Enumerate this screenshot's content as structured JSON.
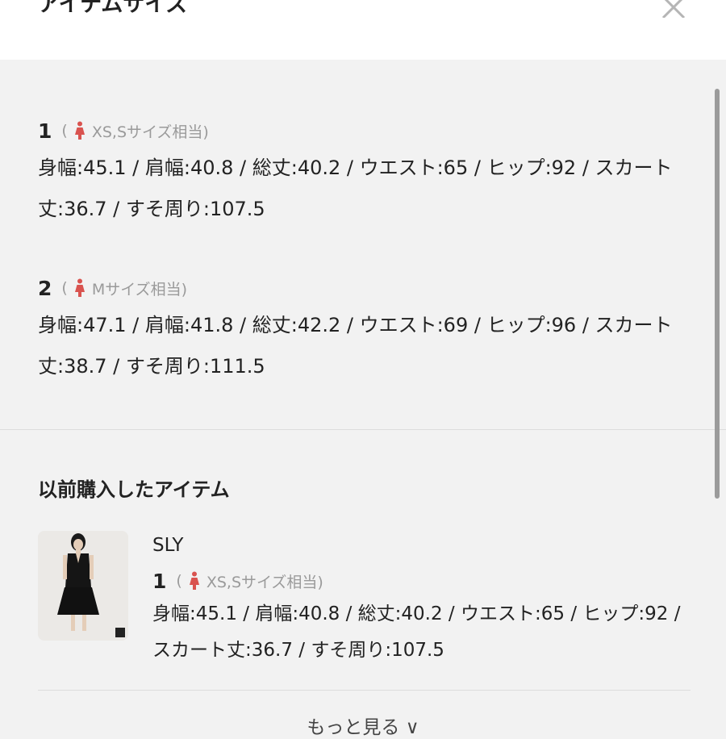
{
  "header": {
    "title": "アイテムサイズ"
  },
  "sizes": [
    {
      "number": "1",
      "paren_open": "(",
      "note": "XS,Sサイズ相当)",
      "measurements": "身幅:45.1 / 肩幅:40.8 / 総丈:40.2 / ウエスト:65 / ヒップ:92 / スカート丈:36.7 / すそ周り:107.5"
    },
    {
      "number": "2",
      "paren_open": "(",
      "note": "Mサイズ相当)",
      "measurements": "身幅:47.1 / 肩幅:41.8 / 総丈:42.2 / ウエスト:69 / ヒップ:96 / スカート丈:38.7 / すそ周り:111.5"
    }
  ],
  "previous": {
    "title": "以前購入したアイテム",
    "item": {
      "brand": "SLY",
      "number": "1",
      "paren_open": "(",
      "note": "XS,Sサイズ相当)",
      "measurements": "身幅:45.1 / 肩幅:40.8 / 総丈:40.2 / ウエスト:65 / ヒップ:92 / スカート丈:36.7 / すそ周り:107.5"
    }
  },
  "more_label": "もっと見る ∨",
  "icons": {
    "close": "close-icon",
    "person": "person-icon"
  },
  "colors": {
    "person_icon": "#d9534f",
    "note_text": "#9a9a9a"
  }
}
